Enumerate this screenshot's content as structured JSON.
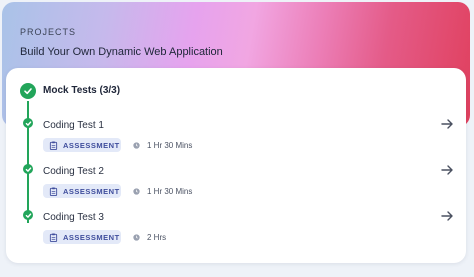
{
  "header": {
    "label": "PROJECTS",
    "title": "Build Your Own Dynamic Web Application"
  },
  "section": {
    "title": "Mock Tests (3/3)",
    "items": [
      {
        "title": "Coding Test 1",
        "badge": "ASSESSMENT",
        "duration": "1 Hr 30 Mins"
      },
      {
        "title": "Coding Test 2",
        "badge": "ASSESSMENT",
        "duration": "1 Hr 30 Mins"
      },
      {
        "title": "Coding Test 3",
        "badge": "ASSESSMENT",
        "duration": "2 Hrs"
      }
    ]
  },
  "colors": {
    "success": "#22a55a",
    "badge_bg": "#e3e9f8",
    "badge_text": "#3f4d9c"
  },
  "icons": {
    "section_status": "check-circle-icon",
    "item_status": "check-circle-icon",
    "badge": "clipboard-icon",
    "duration": "clock-icon",
    "open": "arrow-right-icon"
  }
}
